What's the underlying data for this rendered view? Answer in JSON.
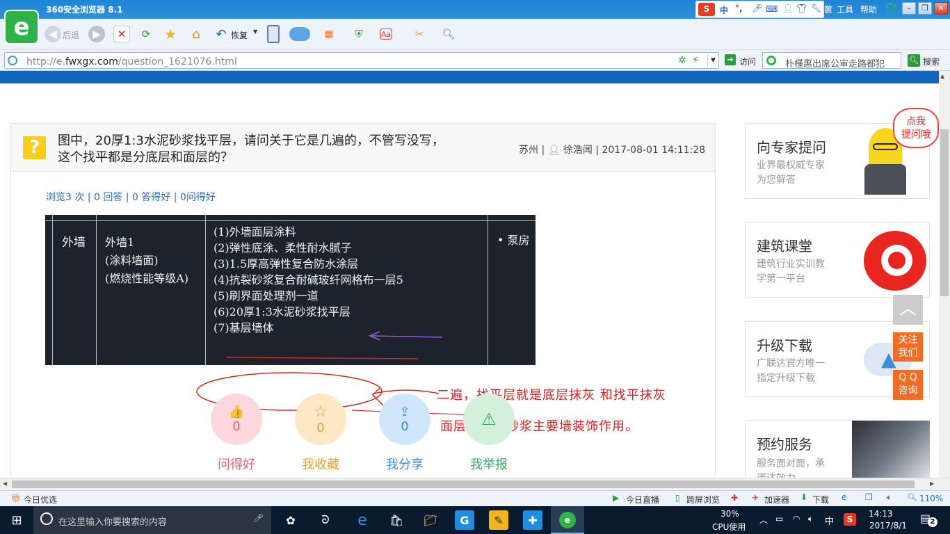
{
  "browser": {
    "title": "360安全浏览器 8.1",
    "logo_glyph": "e",
    "back_label": "后退",
    "restore_label": "恢复",
    "url_host_prefix": "http://e.",
    "url_host": "fwxgx.com",
    "url_path": "/question_1621076.html",
    "visit_label": "访问",
    "search_placeholder": "朴槿惠出席公审走路都犯",
    "search_button": "搜索",
    "menu_tools": "工具",
    "menu_help": "帮助",
    "menu_partial": "篋",
    "ime_lang": "中",
    "ime_punct": "°,"
  },
  "question": {
    "icon_glyph": "?",
    "title_line1": "图中，20厚1:3水泥砂浆找平层，请问关于它是几遍的，不管写没写，",
    "title_line2": "这个找平都是分底层和面层的？",
    "location": "苏州",
    "author": "徐浩闻",
    "datetime": "2017-08-01 14:11:28",
    "separator": "|",
    "stats_line": "浏览3 次 | 0 回答 | 0 答得好 | 0问得好"
  },
  "figure": {
    "col1": "外墙",
    "col2": [
      "外墙1",
      "(涂料墙面)",
      "(燃烧性能等级A)"
    ],
    "col3": [
      "(1)外墙面层涂料",
      "(2)弹性底涂、柔性耐水腻子",
      "(3)1.5厚高弹性复合防水涂层",
      "(4)抗裂砂浆复合耐碱玻纤网格布一层5",
      "(5)刷界面处理剂一道",
      "(6)20厚1:3水泥砂浆找平层",
      "(7)基层墙体"
    ],
    "col4": "• 泵房",
    "annotation_line1": "二遍，找平层就是底层抹灰 和找平抹灰",
    "annotation_line2": "面层是抗裂砂浆主要墙装饰作用。"
  },
  "actions": [
    {
      "count": "0",
      "label": "问得好",
      "color": "#e8646f",
      "bg": "#fcd7db",
      "icon": "thumb-up-icon",
      "glyph": "👍"
    },
    {
      "count": "0",
      "label": "我收藏",
      "color": "#e0a23b",
      "bg": "#fde7c4",
      "icon": "star-icon",
      "glyph": "☆"
    },
    {
      "count": "0",
      "label": "我分享",
      "color": "#3b8fd6",
      "bg": "#cfe6fb",
      "icon": "share-icon",
      "glyph": "⇪"
    },
    {
      "count": "",
      "label": "我举报",
      "color": "#3aa860",
      "bg": "#d2f0da",
      "icon": "warning-icon",
      "glyph": "⚠"
    }
  ],
  "sidebar": {
    "expert": {
      "title": "向专家提问",
      "sub1": "业界最权威专家",
      "sub2": "为您解答",
      "bubble": "点我\n提问哦"
    },
    "course": {
      "title": "建筑课堂",
      "sub1": "建筑行业实训教",
      "sub2": "学第一平台"
    },
    "download": {
      "title": "升级下载",
      "sub1": "广联达官方唯一",
      "sub2": "指定升级下载"
    },
    "booking": {
      "title": "预约服务",
      "sub1": "服务面对面，承",
      "sub2": "诺达效力"
    }
  },
  "floating": {
    "follow": "关注\n我们",
    "qq": "Q Q\n咨询",
    "top_glyph": "︿"
  },
  "statusbar": {
    "today_pick": "今日优选",
    "live": "今日直播",
    "cross_screen": "跨屏浏览",
    "accelerator": "加速器",
    "download": "下载",
    "zoom": "110%"
  },
  "taskbar": {
    "search_placeholder": "在这里输入你要搜索的内容",
    "cpu_percent": "30%",
    "cpu_label": "CPU使用",
    "ime": "中",
    "time": "14:13",
    "date": "2017/8/1",
    "notifications": "2"
  }
}
